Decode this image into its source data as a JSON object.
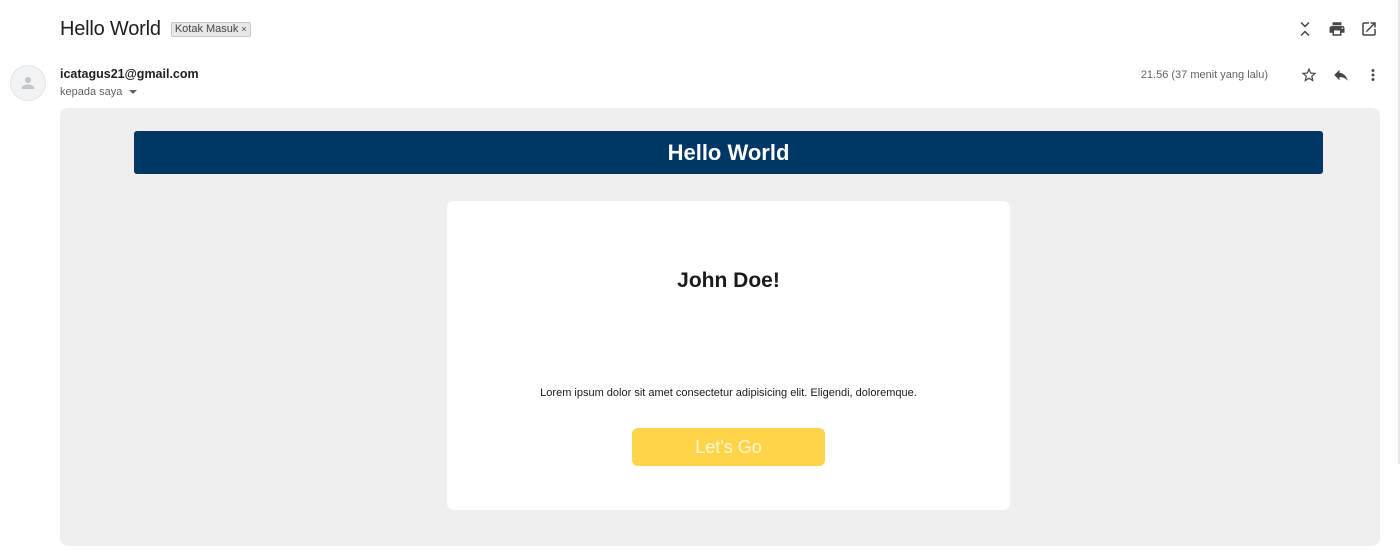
{
  "email": {
    "subject": "Hello World",
    "label_chip": "Kotak Masuk",
    "label_remove": "×",
    "sender": "icatagus21@gmail.com",
    "to_line": "kepada saya",
    "timestamp": "21.56 (37 menit yang lalu)"
  },
  "toolbar_icons": [
    "collapse-icon",
    "print-icon",
    "open-in-new-window-icon"
  ],
  "message_icons": [
    "star-icon",
    "reply-icon",
    "more-vert-icon"
  ],
  "content": {
    "header_title": "Hello World",
    "greeting": "John Doe!",
    "body_text": "Lorem ipsum dolor sit amet consectetur adipisicing elit. Eligendi, doloremque.",
    "cta_label": "Let's Go"
  },
  "colors": {
    "header_bg": "#003764",
    "cta_bg": "#ffd449",
    "body_bg": "#efefef"
  }
}
